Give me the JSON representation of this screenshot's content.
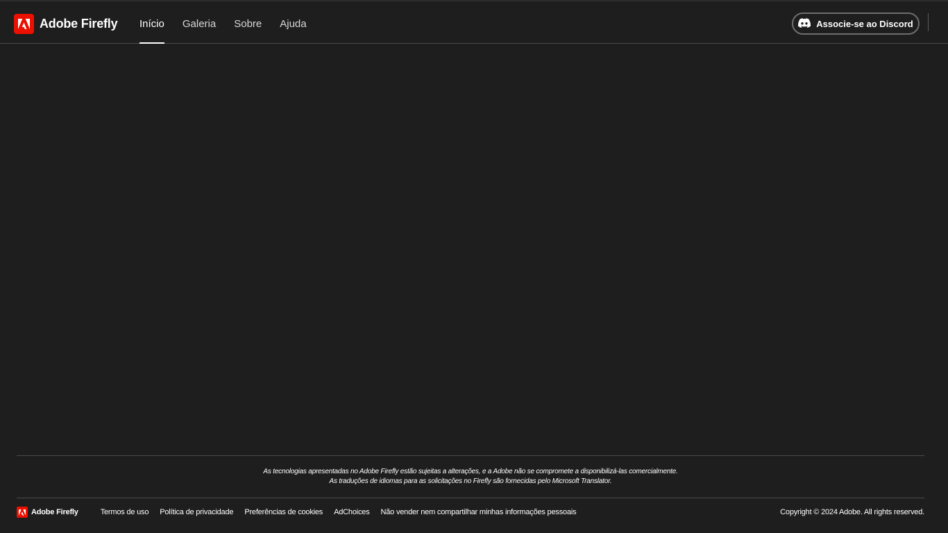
{
  "header": {
    "brand_name": "Adobe Firefly",
    "logo_icon": "adobe-logo-icon",
    "nav": [
      {
        "label": "Início",
        "active": true
      },
      {
        "label": "Galeria",
        "active": false
      },
      {
        "label": "Sobre",
        "active": false
      },
      {
        "label": "Ajuda",
        "active": false
      }
    ],
    "discord_button_label": "Associe-se ao Discord",
    "discord_icon": "discord-icon"
  },
  "footer": {
    "disclaimer_line1": "As tecnologias apresentadas no Adobe Firefly estão sujeitas a alterações, e a Adobe não se compromete a disponibilizá-las comercialmente.",
    "disclaimer_line2": "As traduções de idiomas para as solicitações no Firefly são fornecidas pelo Microsoft Translator.",
    "brand_name": "Adobe Firefly",
    "links": [
      "Termos de uso",
      "Política de privacidade",
      "Preferências de cookies",
      "AdChoices",
      "Não vender nem compartilhar minhas informações pessoais"
    ],
    "copyright": "Copyright © 2024 Adobe. All rights reserved."
  },
  "colors": {
    "background": "#1e1e1e",
    "adobe_red": "#eb1000",
    "text": "#ffffff",
    "divider": "#4a4a4a"
  }
}
